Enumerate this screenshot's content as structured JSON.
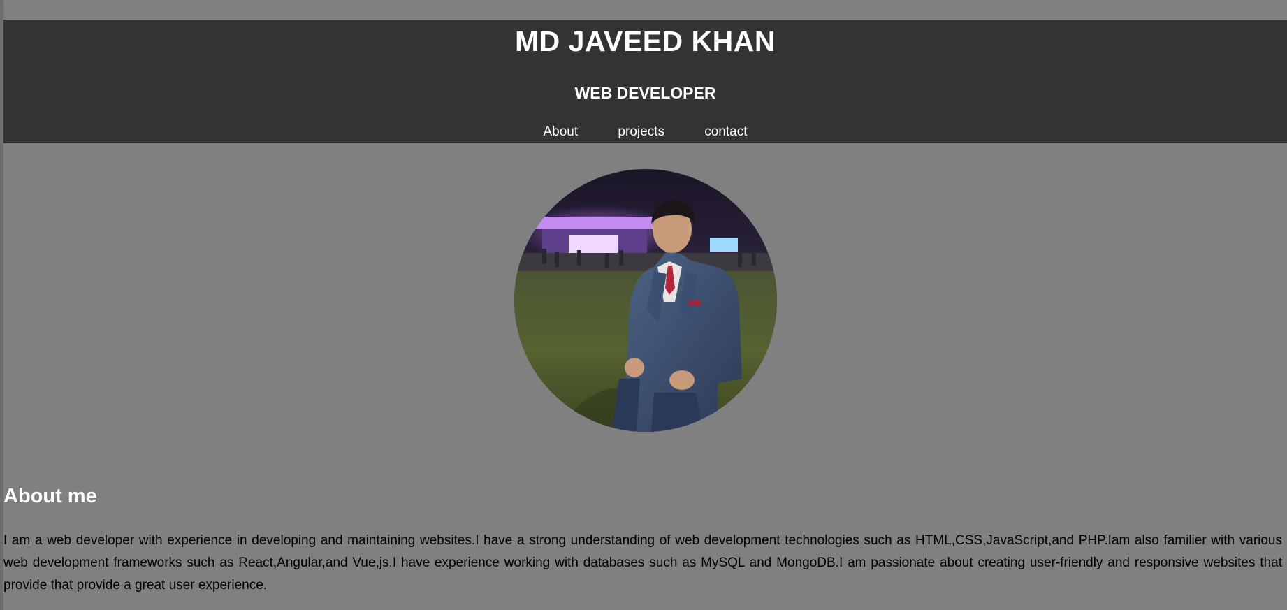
{
  "header": {
    "name": "MD JAVEED KHAN",
    "role": "WEB DEVELOPER"
  },
  "nav": {
    "items": [
      {
        "label": "About"
      },
      {
        "label": "projects"
      },
      {
        "label": "contact"
      }
    ]
  },
  "profile": {
    "photo_alt": "profile-photo"
  },
  "about": {
    "heading": "About me",
    "text": "I am a web developer with experience in developing and maintaining websites.I have a strong understanding of web development technologies such as HTML,CSS,JavaScript,and PHP.Iam also familier with various web development frameworks such as React,Angular,and Vue,js.I have experience working with databases such as MySQL and MongoDB.I am passionate about creating user-friendly and responsive websites that provide that provide a great user experience."
  },
  "colors": {
    "page_background": "#808080",
    "header_background": "#333333",
    "heading_text": "#ffffff",
    "body_text": "#000000"
  }
}
